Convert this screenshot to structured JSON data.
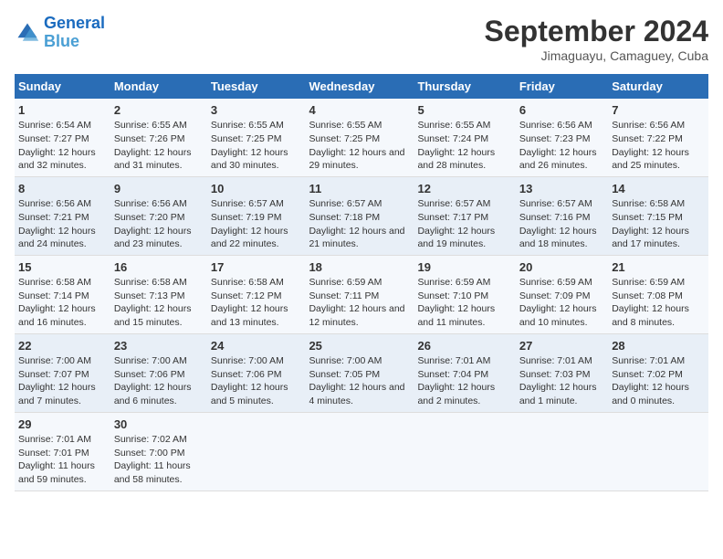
{
  "header": {
    "logo_line1": "General",
    "logo_line2": "Blue",
    "month": "September 2024",
    "location": "Jimaguayu, Camaguey, Cuba"
  },
  "days_of_week": [
    "Sunday",
    "Monday",
    "Tuesday",
    "Wednesday",
    "Thursday",
    "Friday",
    "Saturday"
  ],
  "weeks": [
    [
      {
        "day": "1",
        "sunrise": "6:54 AM",
        "sunset": "7:27 PM",
        "daylight": "12 hours and 32 minutes."
      },
      {
        "day": "2",
        "sunrise": "6:55 AM",
        "sunset": "7:26 PM",
        "daylight": "12 hours and 31 minutes."
      },
      {
        "day": "3",
        "sunrise": "6:55 AM",
        "sunset": "7:25 PM",
        "daylight": "12 hours and 30 minutes."
      },
      {
        "day": "4",
        "sunrise": "6:55 AM",
        "sunset": "7:25 PM",
        "daylight": "12 hours and 29 minutes."
      },
      {
        "day": "5",
        "sunrise": "6:55 AM",
        "sunset": "7:24 PM",
        "daylight": "12 hours and 28 minutes."
      },
      {
        "day": "6",
        "sunrise": "6:56 AM",
        "sunset": "7:23 PM",
        "daylight": "12 hours and 26 minutes."
      },
      {
        "day": "7",
        "sunrise": "6:56 AM",
        "sunset": "7:22 PM",
        "daylight": "12 hours and 25 minutes."
      }
    ],
    [
      {
        "day": "8",
        "sunrise": "6:56 AM",
        "sunset": "7:21 PM",
        "daylight": "12 hours and 24 minutes."
      },
      {
        "day": "9",
        "sunrise": "6:56 AM",
        "sunset": "7:20 PM",
        "daylight": "12 hours and 23 minutes."
      },
      {
        "day": "10",
        "sunrise": "6:57 AM",
        "sunset": "7:19 PM",
        "daylight": "12 hours and 22 minutes."
      },
      {
        "day": "11",
        "sunrise": "6:57 AM",
        "sunset": "7:18 PM",
        "daylight": "12 hours and 21 minutes."
      },
      {
        "day": "12",
        "sunrise": "6:57 AM",
        "sunset": "7:17 PM",
        "daylight": "12 hours and 19 minutes."
      },
      {
        "day": "13",
        "sunrise": "6:57 AM",
        "sunset": "7:16 PM",
        "daylight": "12 hours and 18 minutes."
      },
      {
        "day": "14",
        "sunrise": "6:58 AM",
        "sunset": "7:15 PM",
        "daylight": "12 hours and 17 minutes."
      }
    ],
    [
      {
        "day": "15",
        "sunrise": "6:58 AM",
        "sunset": "7:14 PM",
        "daylight": "12 hours and 16 minutes."
      },
      {
        "day": "16",
        "sunrise": "6:58 AM",
        "sunset": "7:13 PM",
        "daylight": "12 hours and 15 minutes."
      },
      {
        "day": "17",
        "sunrise": "6:58 AM",
        "sunset": "7:12 PM",
        "daylight": "12 hours and 13 minutes."
      },
      {
        "day": "18",
        "sunrise": "6:59 AM",
        "sunset": "7:11 PM",
        "daylight": "12 hours and 12 minutes."
      },
      {
        "day": "19",
        "sunrise": "6:59 AM",
        "sunset": "7:10 PM",
        "daylight": "12 hours and 11 minutes."
      },
      {
        "day": "20",
        "sunrise": "6:59 AM",
        "sunset": "7:09 PM",
        "daylight": "12 hours and 10 minutes."
      },
      {
        "day": "21",
        "sunrise": "6:59 AM",
        "sunset": "7:08 PM",
        "daylight": "12 hours and 8 minutes."
      }
    ],
    [
      {
        "day": "22",
        "sunrise": "7:00 AM",
        "sunset": "7:07 PM",
        "daylight": "12 hours and 7 minutes."
      },
      {
        "day": "23",
        "sunrise": "7:00 AM",
        "sunset": "7:06 PM",
        "daylight": "12 hours and 6 minutes."
      },
      {
        "day": "24",
        "sunrise": "7:00 AM",
        "sunset": "7:06 PM",
        "daylight": "12 hours and 5 minutes."
      },
      {
        "day": "25",
        "sunrise": "7:00 AM",
        "sunset": "7:05 PM",
        "daylight": "12 hours and 4 minutes."
      },
      {
        "day": "26",
        "sunrise": "7:01 AM",
        "sunset": "7:04 PM",
        "daylight": "12 hours and 2 minutes."
      },
      {
        "day": "27",
        "sunrise": "7:01 AM",
        "sunset": "7:03 PM",
        "daylight": "12 hours and 1 minute."
      },
      {
        "day": "28",
        "sunrise": "7:01 AM",
        "sunset": "7:02 PM",
        "daylight": "12 hours and 0 minutes."
      }
    ],
    [
      {
        "day": "29",
        "sunrise": "7:01 AM",
        "sunset": "7:01 PM",
        "daylight": "11 hours and 59 minutes."
      },
      {
        "day": "30",
        "sunrise": "7:02 AM",
        "sunset": "7:00 PM",
        "daylight": "11 hours and 58 minutes."
      },
      null,
      null,
      null,
      null,
      null
    ]
  ]
}
